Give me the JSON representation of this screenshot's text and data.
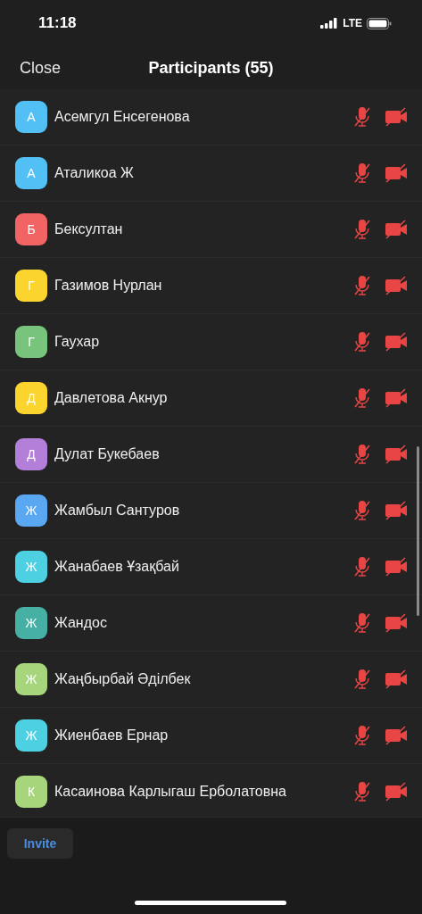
{
  "status_bar": {
    "time": "11:18",
    "network": "LTE"
  },
  "nav": {
    "close": "Close",
    "title": "Participants (55)"
  },
  "participants": [
    {
      "initial": "А",
      "name": "Асемгул Енсегенова",
      "color": "#52c0f5",
      "muted": true,
      "video_off": true
    },
    {
      "initial": "А",
      "name": "Аталикоа Ж",
      "color": "#52c0f5",
      "muted": true,
      "video_off": true
    },
    {
      "initial": "Б",
      "name": "Бексултан",
      "color": "#f26464",
      "muted": true,
      "video_off": true
    },
    {
      "initial": "Г",
      "name": "Газимов Нурлан",
      "color": "#fbd52e",
      "muted": true,
      "video_off": true
    },
    {
      "initial": "Г",
      "name": "Гаухар",
      "color": "#78c47c",
      "muted": true,
      "video_off": true
    },
    {
      "initial": "Д",
      "name": "Давлетова Акнур",
      "color": "#fbd52e",
      "muted": true,
      "video_off": true
    },
    {
      "initial": "Д",
      "name": "Дулат Букебаев",
      "color": "#b37fd8",
      "muted": true,
      "video_off": true
    },
    {
      "initial": "Ж",
      "name": "Жамбыл Сантуров",
      "color": "#5aa8f2",
      "muted": true,
      "video_off": true
    },
    {
      "initial": "Ж",
      "name": "Жанабаев Ұзақбай",
      "color": "#4dd0e2",
      "muted": true,
      "video_off": true
    },
    {
      "initial": "Ж",
      "name": "Жандос",
      "color": "#47b0a4",
      "muted": true,
      "video_off": true
    },
    {
      "initial": "Ж",
      "name": "Жаңбырбай Әділбек",
      "color": "#a6d57c",
      "muted": true,
      "video_off": true
    },
    {
      "initial": "Ж",
      "name": "Жиенбаев Ернар",
      "color": "#4dd0e2",
      "muted": true,
      "video_off": true
    },
    {
      "initial": "К",
      "name": "Касаинова Карлыгаш Ерболатовна",
      "color": "#a6d57c",
      "muted": true,
      "video_off": true
    }
  ],
  "footer": {
    "invite": "Invite"
  }
}
